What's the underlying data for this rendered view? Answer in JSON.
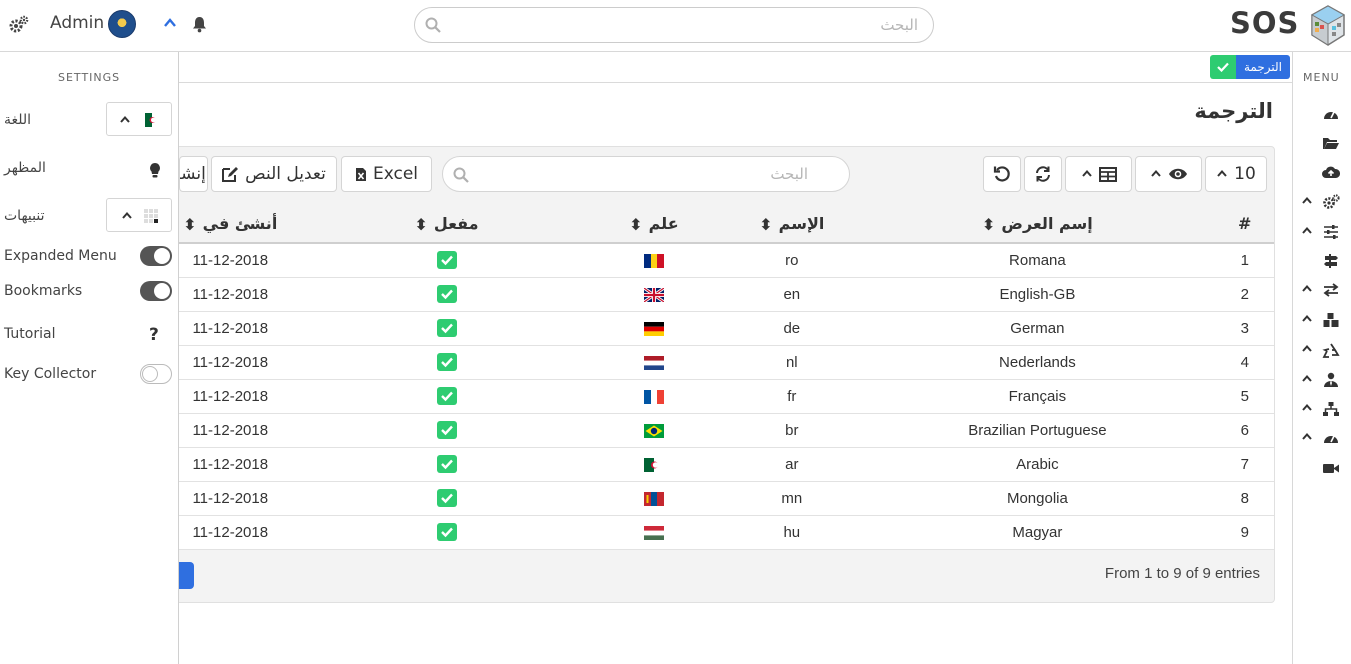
{
  "topbar": {
    "user": "Admin",
    "search_placeholder": "البحث",
    "logo_text": "SOS"
  },
  "rightnav": {
    "title": "MENU",
    "items": [
      {
        "icon": "dashboard-icon",
        "has_caret": false
      },
      {
        "icon": "folder-open-icon",
        "has_caret": false
      },
      {
        "icon": "cloud-upload-icon",
        "has_caret": false
      },
      {
        "icon": "cogs-icon",
        "has_caret": true
      },
      {
        "icon": "sliders-icon",
        "has_caret": true
      },
      {
        "icon": "map-signs-icon",
        "has_caret": false
      },
      {
        "icon": "exchange-icon",
        "has_caret": true
      },
      {
        "icon": "cubes-icon",
        "has_caret": true
      },
      {
        "icon": "recycle-icon",
        "has_caret": true
      },
      {
        "icon": "user-tie-icon",
        "has_caret": true
      },
      {
        "icon": "sitemap-icon",
        "has_caret": true
      },
      {
        "icon": "tachometer-icon",
        "has_caret": true
      },
      {
        "icon": "video-icon",
        "has_caret": false
      }
    ]
  },
  "breadcrumb": {
    "label": "الترجمة"
  },
  "page": {
    "title": "الترجمة"
  },
  "toolbar": {
    "page_size": "10",
    "search_placeholder": "البحث",
    "excel_label": "Excel",
    "edit_text_label": "تعديل النص",
    "create_label_partial": "إنشا"
  },
  "table": {
    "columns": {
      "num": "#",
      "display_name": "إسم العرض",
      "name": "الإسم",
      "flag": "علم",
      "active": "مفعل",
      "created": "أنشئ في"
    },
    "rows": [
      {
        "num": "1",
        "display_name": "Romana",
        "name": "ro",
        "flag": "ro",
        "active": true,
        "created": "11-12-2018"
      },
      {
        "num": "2",
        "display_name": "English-GB",
        "name": "en",
        "flag": "gb",
        "active": true,
        "created": "11-12-2018"
      },
      {
        "num": "3",
        "display_name": "German",
        "name": "de",
        "flag": "de",
        "active": true,
        "created": "11-12-2018"
      },
      {
        "num": "4",
        "display_name": "Nederlands",
        "name": "nl",
        "flag": "nl",
        "active": true,
        "created": "11-12-2018"
      },
      {
        "num": "5",
        "display_name": "Français",
        "name": "fr",
        "flag": "fr",
        "active": true,
        "created": "11-12-2018"
      },
      {
        "num": "6",
        "display_name": "Brazilian Portuguese",
        "name": "br",
        "flag": "br",
        "active": true,
        "created": "11-12-2018"
      },
      {
        "num": "7",
        "display_name": "Arabic",
        "name": "ar",
        "flag": "dz",
        "active": true,
        "created": "11-12-2018"
      },
      {
        "num": "8",
        "display_name": "Mongolia",
        "name": "mn",
        "flag": "mn",
        "active": true,
        "created": "11-12-2018"
      },
      {
        "num": "9",
        "display_name": "Magyar",
        "name": "hu",
        "flag": "hu",
        "active": true,
        "created": "11-12-2018"
      }
    ]
  },
  "footer": {
    "entries": "From 1 to 9 of 9 entries"
  },
  "settings": {
    "title": "SETTINGS",
    "language_label": "اللغة",
    "theme_label": "المظهر",
    "notifications_label": "تنبيهات",
    "expanded_menu_label": "Expanded Menu",
    "expanded_menu_on": true,
    "bookmarks_label": "Bookmarks",
    "bookmarks_on": true,
    "tutorial_label": "Tutorial",
    "key_collector_label": "Key Collector",
    "key_collector_on": false
  },
  "colors": {
    "accent_blue": "#2f6fe0",
    "success_green": "#2ecc71",
    "toggle_dark": "#555555"
  }
}
